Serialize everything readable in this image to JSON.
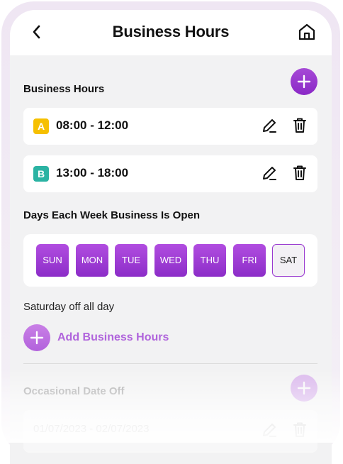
{
  "header": {
    "title": "Business Hours",
    "back_icon": "chevron-left-icon",
    "home_icon": "home-icon"
  },
  "business_hours": {
    "label": "Business Hours",
    "add_icon": "plus-icon",
    "slots": [
      {
        "badge": "A",
        "badge_color": "#f6c000",
        "time": "08:00 - 12:00"
      },
      {
        "badge": "B",
        "badge_color": "#2bb3a3",
        "time": "13:00 - 18:00"
      }
    ]
  },
  "days": {
    "label": "Days Each Week Business Is Open",
    "items": [
      {
        "label": "SUN",
        "open": true
      },
      {
        "label": "MON",
        "open": true
      },
      {
        "label": "TUE",
        "open": true
      },
      {
        "label": "WED",
        "open": true
      },
      {
        "label": "THU",
        "open": true
      },
      {
        "label": "FRI",
        "open": true
      },
      {
        "label": "SAT",
        "open": false
      }
    ],
    "note": "Saturday off all day"
  },
  "add_business_hours": {
    "label": "Add Business Hours"
  },
  "occasional": {
    "label": "Occasional Date Off",
    "entry": "01/07/2023 - 02/07/2023"
  },
  "colors": {
    "accent": "#9b3bd3",
    "accent_light": "#b064dc",
    "badge_a": "#f6c000",
    "badge_b": "#2bb3a3"
  }
}
